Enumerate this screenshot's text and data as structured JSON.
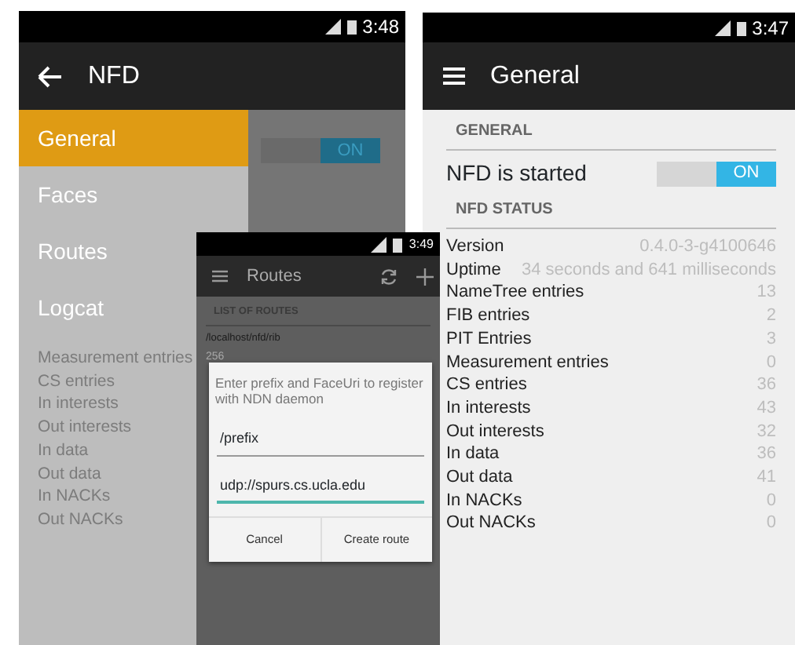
{
  "drawer_screen": {
    "status_bar": {
      "time": "3:48"
    },
    "app_bar": {
      "title": "NFD"
    },
    "drawer": {
      "items": [
        {
          "label": "General",
          "selected": true
        },
        {
          "label": "Faces",
          "selected": false
        },
        {
          "label": "Routes",
          "selected": false
        },
        {
          "label": "Logcat",
          "selected": false
        }
      ]
    },
    "dimmed_content": {
      "toggle": {
        "text": "ON",
        "on": true
      },
      "labels": [
        "Measurement entries",
        "CS entries",
        "In interests",
        "Out interests",
        "In data",
        "Out data",
        "In NACKs",
        "Out NACKs"
      ]
    }
  },
  "routes_screen": {
    "status_bar": {
      "time": "3:49"
    },
    "app_bar": {
      "title": "Routes"
    },
    "section_header": "LIST OF ROUTES",
    "routes": [
      {
        "prefix": "/localhost/nfd/rib",
        "face": "256"
      }
    ],
    "dialog": {
      "message": "Enter prefix and FaceUri to register with NDN daemon",
      "fields": [
        {
          "value": "/prefix",
          "focused": false
        },
        {
          "value": "udp://spurs.cs.ucla.edu",
          "focused": true
        }
      ],
      "buttons": [
        "Cancel",
        "Create route"
      ]
    }
  },
  "general_screen": {
    "status_bar": {
      "time": "3:47"
    },
    "app_bar": {
      "title": "General"
    },
    "general_header": "GENERAL",
    "nfd_switch": {
      "label": "NFD is started",
      "state_text": "ON",
      "on": true
    },
    "status_header": "NFD STATUS",
    "stats": [
      {
        "label": "Version",
        "value": "0.4.0-3-g4100646"
      },
      {
        "label": "Uptime",
        "value": "34 seconds and 641 milliseconds"
      },
      {
        "label": "NameTree entries",
        "value": "13"
      },
      {
        "label": "FIB entries",
        "value": "2"
      },
      {
        "label": "PIT Entries",
        "value": "3"
      },
      {
        "label": "Measurement entries",
        "value": "0"
      },
      {
        "label": "CS entries",
        "value": "36"
      },
      {
        "label": "In interests",
        "value": "43"
      },
      {
        "label": "Out interests",
        "value": "32"
      },
      {
        "label": "In data",
        "value": "36"
      },
      {
        "label": "Out data",
        "value": "41"
      },
      {
        "label": "In NACKs",
        "value": "0"
      },
      {
        "label": "Out NACKs",
        "value": "0"
      }
    ]
  }
}
